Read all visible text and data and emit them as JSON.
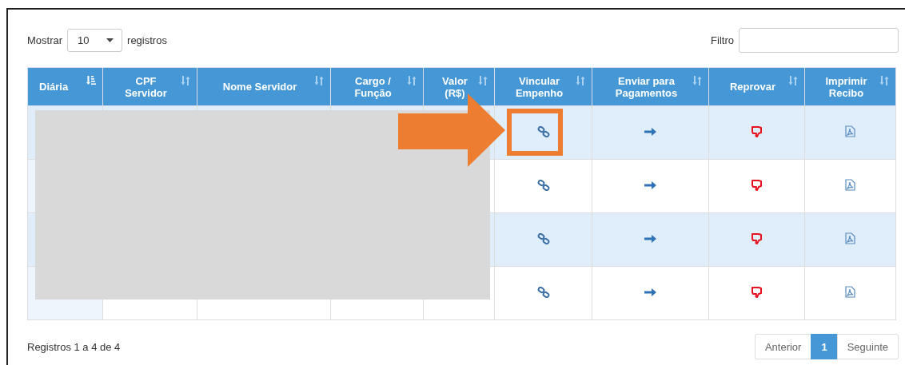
{
  "length_control": {
    "label_before": "Mostrar",
    "value": "10",
    "label_after": "registros"
  },
  "filter": {
    "label": "Filtro"
  },
  "table": {
    "columns": [
      {
        "label": "Diária",
        "sorted": true
      },
      {
        "label": "CPF Servidor",
        "sorted": false
      },
      {
        "label": "Nome Servidor",
        "sorted": false
      },
      {
        "label": "Cargo / Função",
        "sorted": false
      },
      {
        "label": "Valor (R$)",
        "sorted": false
      },
      {
        "label": "Vincular Empenho",
        "sorted": false
      },
      {
        "label": "Enviar para Pagamentos",
        "sorted": false
      },
      {
        "label": "Reprovar",
        "sorted": false
      },
      {
        "label": "Imprimir Recibo",
        "sorted": false
      }
    ],
    "rows": [
      {
        "shaded": true
      },
      {
        "shaded": false
      },
      {
        "shaded": true
      },
      {
        "shaded": false
      }
    ]
  },
  "info": "Registros 1 a 4 de 4",
  "pagination": [
    {
      "label": "Anterior",
      "selected": false
    },
    {
      "label": "1",
      "selected": true
    },
    {
      "label": "Seguinte",
      "selected": false
    }
  ]
}
